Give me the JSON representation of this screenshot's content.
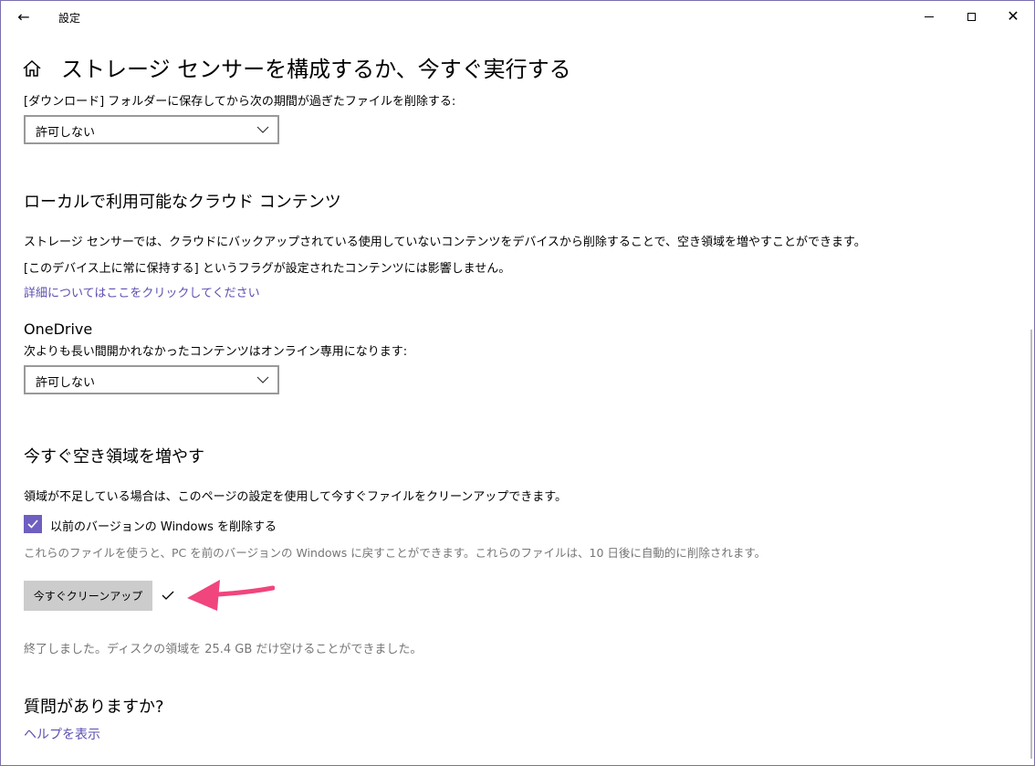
{
  "window": {
    "app_title": "設定",
    "back": "←",
    "close": "✕"
  },
  "page": {
    "title": "ストレージ センサーを構成するか、今すぐ実行する"
  },
  "downloads": {
    "label": "[ダウンロード] フォルダーに保存してから次の期間が過ぎたファイルを削除する:",
    "selected": "許可しない"
  },
  "cloud": {
    "heading": "ローカルで利用可能なクラウド コンテンツ",
    "desc1": "ストレージ センサーでは、クラウドにバックアップされている使用していないコンテンツをデバイスから削除することで、空き領域を増やすことができます。",
    "desc2": "[このデバイス上に常に保持する] というフラグが設定されたコンテンツには影響しません。",
    "link": "詳細についてはここをクリックしてください"
  },
  "onedrive": {
    "heading": "OneDrive",
    "label": "次よりも長い間開かれなかったコンテンツはオンライン専用になります:",
    "selected": "許可しない"
  },
  "free_space": {
    "heading": "今すぐ空き領域を増やす",
    "desc": "領域が不足している場合は、このページの設定を使用して今すぐファイルをクリーンアップできます。",
    "checkbox_label": "以前のバージョンの Windows を削除する",
    "checkbox_checked": true,
    "checkbox_note": "これらのファイルを使うと、PC を前のバージョンの Windows に戻すことができます。これらのファイルは、10 日後に自動的に削除されます。",
    "button_label": "今すぐクリーンアップ",
    "result": "終了しました。ディスクの領域を 25.4 GB だけ空けることができました。"
  },
  "help": {
    "heading": "質問がありますか?",
    "link": "ヘルプを表示"
  },
  "colors": {
    "accent": "#6e5fc0",
    "link": "#5c4fb0",
    "annotation_arrow": "#f0457d"
  },
  "icons": [
    "back-arrow-icon",
    "minimize-icon",
    "maximize-icon",
    "close-icon",
    "home-icon",
    "chevron-down-icon",
    "checkmark-icon",
    "pink-arrow-annotation"
  ]
}
